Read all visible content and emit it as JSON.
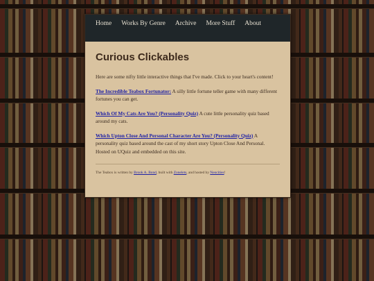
{
  "nav": {
    "items": [
      "Home",
      "Works By Genre",
      "Archive",
      "More Stuff",
      "About"
    ]
  },
  "page": {
    "title": "Curious Clickables",
    "intro": "Here are some nifty little interactive things that I've made. Click to your heart's content!"
  },
  "entries": [
    {
      "link": "The Incredible Teabox Fortunator:",
      "desc": " A silly little fortune teller game with many different fortunes you can get."
    },
    {
      "link": "Which Of My Cats Are You? (Personality Quiz)",
      "desc": " A cute little personality quiz based around my cats."
    },
    {
      "link": "Which Upton Close And Personal Character Are You? (Personality Quiz)",
      "desc": " A personality quiz based around the cast of my short story Upton Close And Personal. Hosted on UQuiz and embedded on this site."
    }
  ],
  "footer": {
    "prefix": "The Teabox is written by ",
    "author": "Brook A. Bond",
    "mid1": ", built with ",
    "builder": "Zonelets",
    "mid2": ", and hosted by ",
    "host": "Neocities",
    "suffix": "!"
  },
  "colors": {
    "nav_bg": "#1f2629",
    "panel_bg": "#d9c3a0",
    "link": "#1c1fa6",
    "title": "#3d2a1c"
  }
}
